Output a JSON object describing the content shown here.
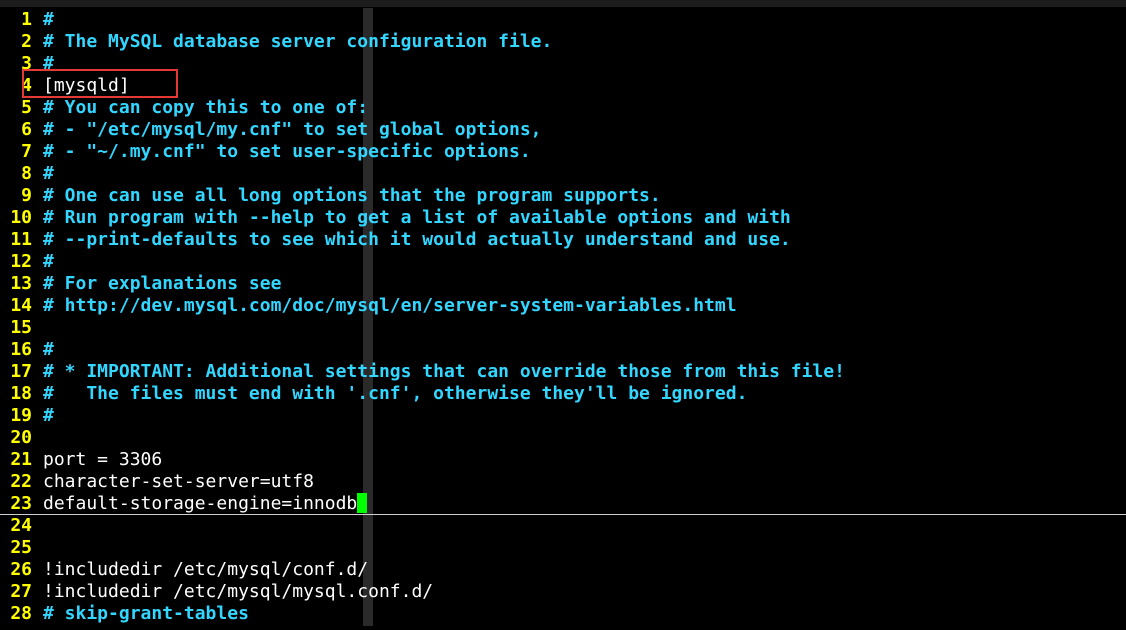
{
  "editor": {
    "lines": [
      {
        "num": "1",
        "text": "#",
        "comment": true
      },
      {
        "num": "2",
        "text": "# The MySQL database server configuration file.",
        "comment": true
      },
      {
        "num": "3",
        "text": "#",
        "comment": true
      },
      {
        "num": "4",
        "text": "[mysqld]",
        "comment": false
      },
      {
        "num": "5",
        "text": "# You can copy this to one of:",
        "comment": true
      },
      {
        "num": "6",
        "text": "# - \"/etc/mysql/my.cnf\" to set global options,",
        "comment": true
      },
      {
        "num": "7",
        "text": "# - \"~/.my.cnf\" to set user-specific options.",
        "comment": true
      },
      {
        "num": "8",
        "text": "#",
        "comment": true
      },
      {
        "num": "9",
        "text": "# One can use all long options that the program supports.",
        "comment": true
      },
      {
        "num": "10",
        "text": "# Run program with --help to get a list of available options and with",
        "comment": true
      },
      {
        "num": "11",
        "text": "# --print-defaults to see which it would actually understand and use.",
        "comment": true
      },
      {
        "num": "12",
        "text": "#",
        "comment": true
      },
      {
        "num": "13",
        "text": "# For explanations see",
        "comment": true
      },
      {
        "num": "14",
        "text": "# http://dev.mysql.com/doc/mysql/en/server-system-variables.html",
        "comment": true
      },
      {
        "num": "15",
        "text": "",
        "comment": false
      },
      {
        "num": "16",
        "text": "#",
        "comment": true
      },
      {
        "num": "17",
        "text": "# * IMPORTANT: Additional settings that can override those from this file!",
        "comment": true
      },
      {
        "num": "18",
        "text": "#   The files must end with '.cnf', otherwise they'll be ignored.",
        "comment": true
      },
      {
        "num": "19",
        "text": "#",
        "comment": true
      },
      {
        "num": "20",
        "text": "",
        "comment": false
      },
      {
        "num": "21",
        "text": "port = 3306",
        "comment": false
      },
      {
        "num": "22",
        "text": "character-set-server=utf8",
        "comment": false
      },
      {
        "num": "23",
        "text": "default-storage-engine=innodb",
        "comment": false,
        "current": true
      },
      {
        "num": "24",
        "text": "",
        "comment": false
      },
      {
        "num": "25",
        "text": "",
        "comment": false
      },
      {
        "num": "26",
        "text": "!includedir /etc/mysql/conf.d/",
        "comment": false
      },
      {
        "num": "27",
        "text": "!includedir /etc/mysql/mysql.conf.d/",
        "comment": false
      },
      {
        "num": "28",
        "text": "# skip-grant-tables",
        "comment": true
      }
    ]
  },
  "colors": {
    "background": "#000000",
    "line_number": "#ffff00",
    "comment": "#33d6ff",
    "text": "#ffffff",
    "cursor": "#00ff00",
    "highlight_box": "#e53935"
  }
}
